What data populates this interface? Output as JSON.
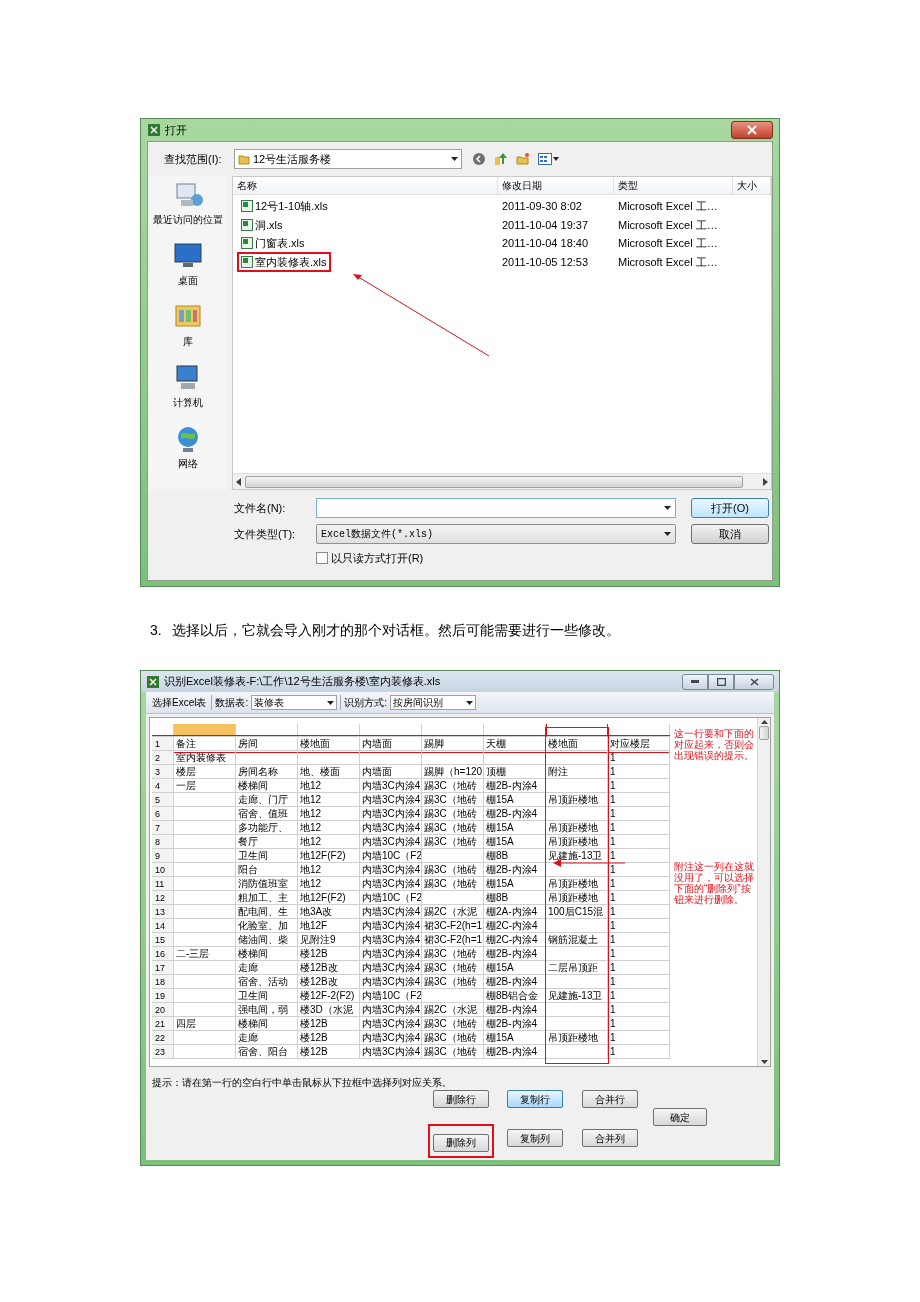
{
  "open_dialog": {
    "title": "打开",
    "look_in_label": "查找范围(I):",
    "look_in_value": "12号生活服务楼",
    "places": [
      {
        "kind": "recent",
        "label": "最近访问的位置"
      },
      {
        "kind": "desktop",
        "label": "桌面"
      },
      {
        "kind": "library",
        "label": "库"
      },
      {
        "kind": "computer",
        "label": "计算机"
      },
      {
        "kind": "network",
        "label": "网络"
      }
    ],
    "columns": [
      "名称",
      "修改日期",
      "类型",
      "大小"
    ],
    "files": [
      {
        "name": "12号1-10轴.xls",
        "modified": "2011-09-30 8:02",
        "type": "Microsoft Excel 工…",
        "highlighted": false
      },
      {
        "name": "洞.xls",
        "modified": "2011-10-04 19:37",
        "type": "Microsoft Excel 工…",
        "highlighted": false
      },
      {
        "name": "门窗表.xls",
        "modified": "2011-10-04 18:40",
        "type": "Microsoft Excel 工…",
        "highlighted": false
      },
      {
        "name": "室内装修表.xls",
        "modified": "2011-10-05 12:53",
        "type": "Microsoft Excel 工…",
        "highlighted": true
      }
    ],
    "file_name_label": "文件名(N):",
    "file_type_label": "文件类型(T):",
    "file_type_value": "Excel数据文件(*.xls)",
    "readonly": {
      "label": "以只读方式打开(R)",
      "checked": false
    },
    "buttons": [
      {
        "label": "打开(O)",
        "focused": true
      },
      {
        "label": "取消",
        "focused": false
      }
    ]
  },
  "paragraph": {
    "number": "3.",
    "text": "选择以后，它就会导入刚才的那个对话框。然后可能需要进行一些修改。"
  },
  "import_dialog": {
    "title": "识别Excel装修表-F:\\工作\\12号生活服务楼\\室内装修表.xls",
    "toolbar": {
      "select_button": "选择Excel表",
      "sheet_label": "数据表:",
      "sheet_value": "装修表",
      "mode_label": "识别方式:",
      "mode_value": "按房间识别"
    },
    "columns": [
      {
        "selected": true,
        "highlighted": false
      },
      {
        "selected": false,
        "highlighted": false
      },
      {
        "selected": false,
        "highlighted": false
      },
      {
        "selected": false,
        "highlighted": false
      },
      {
        "selected": false,
        "highlighted": false
      },
      {
        "selected": false,
        "highlighted": false
      },
      {
        "selected": false,
        "highlighted": true
      },
      {
        "selected": false,
        "highlighted": false
      }
    ],
    "rows": [
      {
        "number": "1",
        "highlighted": true,
        "cells": [
          "备注",
          "房间",
          "楼地面",
          "内墙面",
          "踢脚",
          "天棚",
          "楼地面",
          "对应楼层"
        ]
      },
      {
        "number": "2",
        "highlighted": false,
        "cells": [
          "室内装修表",
          null,
          null,
          null,
          null,
          null,
          null,
          "1"
        ]
      },
      {
        "number": "3",
        "highlighted": false,
        "cells": [
          "楼层",
          "房间名称",
          "地、楼面",
          "内墙面",
          "踢脚（h=120",
          "顶棚",
          "附注",
          "1"
        ]
      },
      {
        "number": "4",
        "highlighted": false,
        "cells": [
          "一层",
          "楼梯间",
          "地12",
          "内墙3C内涂4",
          "踢3C（地砖",
          "棚2B-内涂4",
          null,
          "1"
        ]
      },
      {
        "number": "5",
        "highlighted": false,
        "cells": [
          null,
          "走廊、门厅",
          "地12",
          "内墙3C内涂4",
          "踢3C（地砖",
          "棚15A",
          "吊顶距楼地",
          "1"
        ]
      },
      {
        "number": "6",
        "highlighted": false,
        "cells": [
          null,
          "宿舍、值班",
          "地12",
          "内墙3C内涂4",
          "踢3C（地砖",
          "棚2B-内涂4",
          null,
          "1"
        ]
      },
      {
        "number": "7",
        "highlighted": false,
        "cells": [
          null,
          "多功能厅、",
          "地12",
          "内墙3C内涂4",
          "踢3C（地砖",
          "棚15A",
          "吊顶距楼地",
          "1"
        ]
      },
      {
        "number": "8",
        "highlighted": false,
        "cells": [
          null,
          "餐厅",
          "地12",
          "内墙3C内涂4",
          "踢3C（地砖",
          "棚15A",
          "吊顶距楼地",
          "1"
        ]
      },
      {
        "number": "9",
        "highlighted": false,
        "cells": [
          null,
          "卫生间",
          "地12F(F2)",
          "内墙10C（F2",
          null,
          "棚8B",
          "见建施-13卫",
          "1"
        ]
      },
      {
        "number": "10",
        "highlighted": false,
        "cells": [
          null,
          "阳台",
          "地12",
          "内墙3C内涂4",
          "踢3C（地砖",
          "棚2B-内涂4",
          null,
          "1"
        ]
      },
      {
        "number": "11",
        "highlighted": false,
        "cells": [
          null,
          "消防值班室",
          "地12",
          "内墙3C内涂4",
          "踢3C（地砖",
          "棚15A",
          "吊顶距楼地",
          "1"
        ]
      },
      {
        "number": "12",
        "highlighted": false,
        "cells": [
          null,
          "粗加工、主",
          "地12F(F2)",
          "内墙10C（F2",
          null,
          "棚8B",
          "吊顶距楼地",
          "1"
        ]
      },
      {
        "number": "13",
        "highlighted": false,
        "cells": [
          null,
          "配电间、生",
          "地3A改",
          "内墙3C内涂4",
          "踢2C（水泥",
          "棚2A-内涂4",
          "100后C15混",
          "1"
        ]
      },
      {
        "number": "14",
        "highlighted": false,
        "cells": [
          null,
          "化验室、加",
          "地12F",
          "内墙3C内涂4",
          "裙3C-F2(h=1",
          "棚2C-内涂4",
          null,
          "1"
        ]
      },
      {
        "number": "15",
        "highlighted": false,
        "cells": [
          null,
          "储油间、柴",
          "见附注9",
          "内墙3C内涂4",
          "裙3C-F2(h=1",
          "棚2C-内涂4",
          "钢筋混凝土",
          "1"
        ]
      },
      {
        "number": "16",
        "highlighted": false,
        "cells": [
          "二-三层",
          "楼梯间",
          "楼12B",
          "内墙3C内涂4",
          "踢3C（地砖",
          "棚2B-内涂4",
          null,
          "1"
        ]
      },
      {
        "number": "17",
        "highlighted": false,
        "cells": [
          null,
          "走廊",
          "楼12B改",
          "内墙3C内涂4",
          "踢3C（地砖",
          "棚15A",
          "二层吊顶距",
          "1"
        ]
      },
      {
        "number": "18",
        "highlighted": false,
        "cells": [
          null,
          "宿舍、活动",
          "楼12B改",
          "内墙3C内涂4",
          "踢3C（地砖",
          "棚2B-内涂4",
          null,
          "1"
        ]
      },
      {
        "number": "19",
        "highlighted": false,
        "cells": [
          null,
          "卫生间",
          "楼12F-2(F2)",
          "内墙10C（F2",
          null,
          "棚8B铝合金",
          "见建施-13卫",
          "1"
        ]
      },
      {
        "number": "20",
        "highlighted": false,
        "cells": [
          null,
          "强电间，弱",
          "楼3D（水泥",
          "内墙3C内涂4",
          "踢2C（水泥",
          "棚2B-内涂4",
          null,
          "1"
        ]
      },
      {
        "number": "21",
        "highlighted": false,
        "cells": [
          "四层",
          "楼梯间",
          "楼12B",
          "内墙3C内涂4",
          "踢3C（地砖",
          "棚2B-内涂4",
          null,
          "1"
        ]
      },
      {
        "number": "22",
        "highlighted": false,
        "cells": [
          null,
          "走廊",
          "楼12B",
          "内墙3C内涂4",
          "踢3C（地砖",
          "棚15A",
          "吊顶距楼地",
          "1"
        ]
      },
      {
        "number": "23",
        "highlighted": false,
        "cells": [
          null,
          "宿舍、阳台",
          "楼12B",
          "内墙3C内涂4",
          "踢3C（地砖",
          "棚2B-内涂4",
          null,
          "1"
        ]
      }
    ],
    "notes": [
      "这一行要和下面的对应起来，否则会出现错误的提示。",
      "附注这一列在这就没用了，可以选择下面的“删除列”按钮来进行删除。"
    ],
    "hint": "提示：请在第一行的空白行中单击鼠标从下拉框中选择列对应关系。",
    "button_rows": [
      [
        {
          "label": "删除行",
          "focused": false,
          "highlighted": false
        },
        {
          "label": "复制行",
          "focused": true,
          "highlighted": false
        },
        {
          "label": "合并行",
          "focused": false,
          "highlighted": false
        }
      ],
      [
        {
          "label": "删除列",
          "focused": false,
          "highlighted": true
        },
        {
          "label": "复制列",
          "focused": false,
          "highlighted": false
        },
        {
          "label": "合并列",
          "focused": false,
          "highlighted": false
        }
      ]
    ],
    "ok_button": "确定"
  }
}
